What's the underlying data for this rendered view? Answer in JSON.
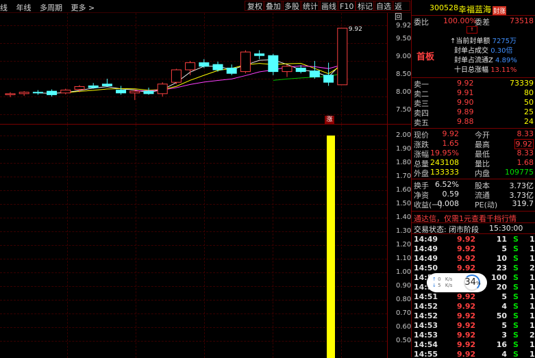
{
  "toolbar": {
    "left_items": [
      "线",
      "年线",
      "多周期",
      "更多"
    ],
    "buttons": [
      "复权",
      "叠加",
      "多股",
      "统计",
      "画线",
      "F10",
      "标记",
      "自选",
      "返回"
    ]
  },
  "price_axis": [
    "9.92",
    "9.50",
    "9.00",
    "8.50",
    "8.00",
    "7.50"
  ],
  "vol_axis": [
    "2.00",
    "1.90",
    "1.80",
    "1.70",
    "1.60",
    "1.50",
    "1.40",
    "1.30",
    "1.20",
    "1.10",
    "1.00",
    "0.90",
    "0.80",
    "0.70",
    "0.60",
    "0.50"
  ],
  "limit_up_badge": "涨",
  "kline": [
    {
      "o": 8.05,
      "h": 8.12,
      "l": 7.98,
      "c": 8.08
    },
    {
      "o": 8.08,
      "h": 8.15,
      "l": 8.02,
      "c": 8.12
    },
    {
      "o": 8.12,
      "h": 8.18,
      "l": 8.05,
      "c": 8.1
    },
    {
      "o": 8.15,
      "h": 8.2,
      "l": 8.0,
      "c": 8.05
    },
    {
      "o": 8.1,
      "h": 8.22,
      "l": 8.06,
      "c": 8.18
    },
    {
      "o": 8.2,
      "h": 8.32,
      "l": 8.12,
      "c": 8.28
    },
    {
      "o": 8.3,
      "h": 8.38,
      "l": 8.22,
      "c": 8.25
    },
    {
      "o": 8.35,
      "h": 8.5,
      "l": 8.28,
      "c": 8.3
    },
    {
      "o": 8.18,
      "h": 8.3,
      "l": 8.05,
      "c": 8.1
    },
    {
      "o": 8.1,
      "h": 8.2,
      "l": 7.9,
      "c": 8.15
    },
    {
      "o": 8.15,
      "h": 8.25,
      "l": 8.05,
      "c": 8.08
    },
    {
      "o": 8.08,
      "h": 8.4,
      "l": 8.0,
      "c": 8.35
    },
    {
      "o": 8.4,
      "h": 8.78,
      "l": 8.35,
      "c": 8.75
    },
    {
      "o": 8.75,
      "h": 9.0,
      "l": 8.6,
      "c": 8.95
    },
    {
      "o": 8.95,
      "h": 9.05,
      "l": 8.8,
      "c": 8.85
    },
    {
      "o": 8.9,
      "h": 8.98,
      "l": 8.7,
      "c": 8.75
    },
    {
      "o": 8.8,
      "h": 8.9,
      "l": 8.6,
      "c": 8.65
    },
    {
      "o": 8.7,
      "h": 9.3,
      "l": 8.65,
      "c": 9.25
    },
    {
      "o": 9.2,
      "h": 9.3,
      "l": 9.05,
      "c": 9.15
    },
    {
      "o": 9.15,
      "h": 9.2,
      "l": 8.6,
      "c": 8.7
    },
    {
      "o": 8.7,
      "h": 8.9,
      "l": 8.55,
      "c": 8.85
    },
    {
      "o": 8.8,
      "h": 8.88,
      "l": 8.65,
      "c": 8.7
    },
    {
      "o": 8.72,
      "h": 9.0,
      "l": 8.5,
      "c": 8.55
    },
    {
      "o": 8.6,
      "h": 8.95,
      "l": 8.3,
      "c": 8.4
    },
    {
      "o": 8.33,
      "h": 9.92,
      "l": 8.33,
      "c": 9.92
    }
  ],
  "high_label": "9.92",
  "volume_bar_value": 2.0,
  "header": {
    "code": "300528",
    "name": "幸福蓝海",
    "tag": "封涨"
  },
  "weibi": {
    "label": "委比",
    "pct": "100.00%",
    "diff_label": "委差",
    "diff": "73518"
  },
  "seal": {
    "board": "首板",
    "items": [
      {
        "label": "当前封单额",
        "value": "7275万"
      },
      {
        "label": "封单占成交",
        "value": "0.30倍"
      },
      {
        "label": "封单占流通Z",
        "value": "4.89%"
      },
      {
        "label": "十日总涨幅",
        "value": "13.11%"
      }
    ]
  },
  "sell_book": [
    {
      "label": "卖一",
      "price": "9.92",
      "vol": "73339"
    },
    {
      "label": "卖二",
      "price": "9.91",
      "vol": "80"
    },
    {
      "label": "卖三",
      "price": "9.90",
      "vol": "50"
    },
    {
      "label": "卖四",
      "price": "9.89",
      "vol": "25"
    },
    {
      "label": "卖五",
      "price": "9.88",
      "vol": "24"
    }
  ],
  "quote": [
    {
      "l1": "现价",
      "v1": "9.92",
      "l2": "今开",
      "v2": "8.33"
    },
    {
      "l1": "涨跌",
      "v1": "1.65",
      "l2": "最高",
      "v2": "9.92"
    },
    {
      "l1": "涨幅",
      "v1": "19.95%",
      "l2": "最低",
      "v2": "8.33"
    },
    {
      "l1": "总量",
      "v1": "243108",
      "l2": "量比",
      "v2": "1.68"
    },
    {
      "l1": "外盘",
      "v1": "133333",
      "l2": "内盘",
      "v2": "109775"
    }
  ],
  "fundamentals": [
    {
      "l1": "换手",
      "v1": "6.52%",
      "l2": "股本",
      "v2": "3.73亿"
    },
    {
      "l1": "净资",
      "v1": "0.59",
      "l2": "流通",
      "v2": "3.73亿"
    },
    {
      "l1": "收益(一)",
      "v1": "0.008",
      "l2": "PE(动)",
      "v2": "319.7"
    }
  ],
  "promo": "通达信，仅需1元查看千档行情",
  "trade_status": {
    "label": "交易状态:",
    "value": "闭市阶段",
    "time": "15:30:00"
  },
  "ticks": [
    {
      "t": "14:49",
      "p": "9.92",
      "v": "11",
      "s": "S",
      "n": "1"
    },
    {
      "t": "14:49",
      "p": "9.92",
      "v": "5",
      "s": "S",
      "n": "1"
    },
    {
      "t": "14:49",
      "p": "9.92",
      "v": "10",
      "s": "S",
      "n": "1"
    },
    {
      "t": "14:50",
      "p": "9.92",
      "v": "23",
      "s": "S",
      "n": "2"
    },
    {
      "t": "14:51",
      "p": "9.92",
      "v": "100",
      "s": "S",
      "n": "1"
    },
    {
      "t": "14:51",
      "p": "9.92",
      "v": "20",
      "s": "S",
      "n": "1"
    },
    {
      "t": "14:51",
      "p": "9.92",
      "v": "5",
      "s": "S",
      "n": "1"
    },
    {
      "t": "14:52",
      "p": "9.92",
      "v": "4",
      "s": "S",
      "n": "1"
    },
    {
      "t": "14:52",
      "p": "9.92",
      "v": "50",
      "s": "S",
      "n": "1"
    },
    {
      "t": "14:53",
      "p": "9.92",
      "v": "5",
      "s": "S",
      "n": "1"
    },
    {
      "t": "14:53",
      "p": "9.92",
      "v": "3",
      "s": "S",
      "n": "2"
    },
    {
      "t": "14:54",
      "p": "9.92",
      "v": "16",
      "s": "S",
      "n": "1"
    },
    {
      "t": "14:55",
      "p": "9.92",
      "v": "4",
      "s": "S",
      "n": "1"
    }
  ],
  "net_widget": {
    "up": "0",
    "down": "5",
    "unit": "K/s",
    "pct": "34",
    "pct_sign": "%"
  }
}
